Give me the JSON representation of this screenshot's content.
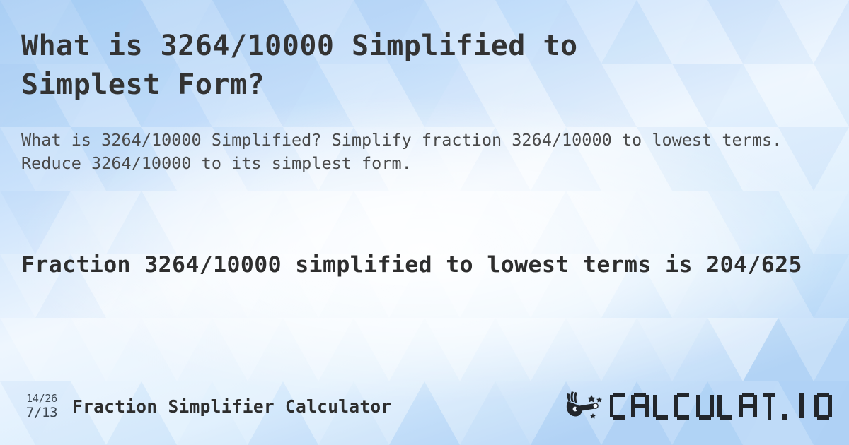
{
  "page": {
    "title_line1": "What is 3264/10000 Simplified to",
    "title_line2": "Simplest Form?",
    "description": "What is 3264/10000 Simplified? Simplify fraction 3264/10000 to lowest terms. Reduce 3264/10000 to its simplest form.",
    "result_line1": "Fraction 3264/10000 simplified to lowest terms",
    "result_line2": "is 204/625"
  },
  "calculation": {
    "fraction_numerator": "3264",
    "fraction_denominator": "10000",
    "fraction_original": "3264/10000",
    "fraction_simplified": "204/625",
    "simplified_numerator": "204",
    "simplified_denominator": "625"
  },
  "footer": {
    "icon_top": "14/26",
    "icon_bottom": "7/13",
    "tool_name": "Fraction Simplifier Calculator",
    "brand_name": "CALCULAT.IO",
    "brand_letters": [
      "C",
      "A",
      "L",
      "C",
      "U",
      "L",
      "A",
      "T",
      ".",
      "I",
      "O"
    ]
  },
  "colors": {
    "title_text": "#333333",
    "body_text": "#4a4a4a",
    "result_text": "#2e2e2e",
    "brand_dark": "#22262b",
    "background_light": "#f7fbff",
    "background_blue": "#a9cef4"
  }
}
